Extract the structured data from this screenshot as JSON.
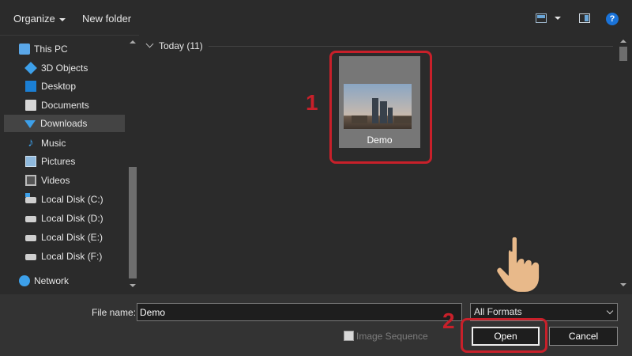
{
  "toolbar": {
    "organize_label": "Organize",
    "new_folder_label": "New folder",
    "help_label": "?"
  },
  "nav": {
    "items": [
      {
        "label": "This PC",
        "icon": "computer-icon"
      },
      {
        "label": "3D Objects",
        "icon": "cube-icon"
      },
      {
        "label": "Desktop",
        "icon": "desktop-icon"
      },
      {
        "label": "Documents",
        "icon": "documents-icon"
      },
      {
        "label": "Downloads",
        "icon": "download-arrow-icon",
        "selected": true
      },
      {
        "label": "Music",
        "icon": "music-note-icon"
      },
      {
        "label": "Pictures",
        "icon": "pictures-icon"
      },
      {
        "label": "Videos",
        "icon": "film-icon"
      },
      {
        "label": "Local Disk (C:)",
        "icon": "drive-icon"
      },
      {
        "label": "Local Disk (D:)",
        "icon": "drive-icon"
      },
      {
        "label": "Local Disk (E:)",
        "icon": "drive-icon"
      },
      {
        "label": "Local Disk (F:)",
        "icon": "drive-icon"
      },
      {
        "label": "Network",
        "icon": "network-icon"
      }
    ]
  },
  "files": {
    "group_label": "Today (11)",
    "items": [
      {
        "name": "Demo"
      }
    ]
  },
  "annotations": {
    "step1": "1",
    "step2": "2",
    "highlight_color": "#c8202a"
  },
  "bottom": {
    "file_name_label": "File name:",
    "file_name_value": "Demo",
    "format_selected": "All Formats",
    "image_sequence_label": "Image Sequence",
    "open_label": "Open",
    "cancel_label": "Cancel"
  }
}
